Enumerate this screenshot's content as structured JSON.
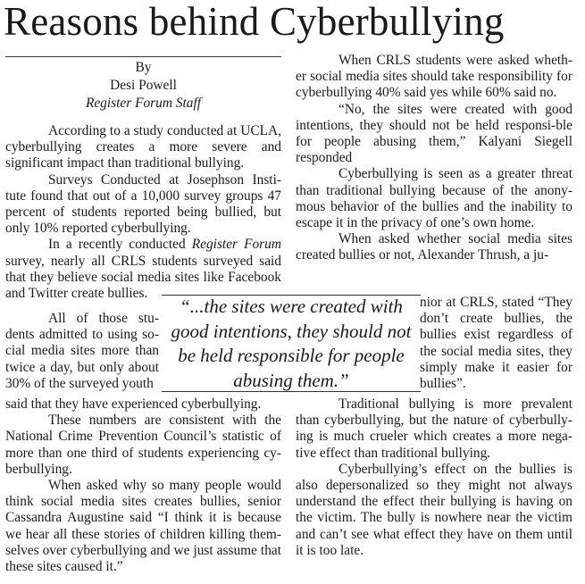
{
  "headline": "Reasons behind Cyberbullying",
  "byline": {
    "by": "By",
    "author": "Desi Powell",
    "staff": "Register Forum Staff"
  },
  "pull_quote": "“...the sites were created with good intentions, they should not be held responsible for people abusing them.”",
  "left_column": {
    "p1": "According to a study conducted at UCLA, cyberbullying creates a more severe and significant impact than traditional bullying.",
    "p2": "Surveys Conducted at Josephson Insti-tute found that out of a 10,000 survey groups 47 percent of students reported being bullied, but only 10% reported cyberbullying.",
    "p3_start": "In a recently conducted ",
    "p3_italic": "Register Forum",
    "p3_end": " survey, nearly all CRLS students surveyed said that they believe social media sites like Facebook and Twitter create bullies.",
    "p4_a": "All of those stu-dents admitted to using so-cial media sites more than twice a day, but only about 30% of the surveyed youth",
    "p4_b": "said that they have experienced cyberbullying.",
    "p5": "These numbers are consistent with the National Crime Prevention Council’s statistic of more than one third of students experiencing cy-berbullying.",
    "p6": "When asked why so many people would think social media sites creates bullies, senior Cassandra Augustine said “I think it is because we hear all these stories of children killing them-selves over cyberbullying and we just assume that these sites caused it.”"
  },
  "right_column": {
    "p1": "When CRLS students were asked wheth-er social media sites should take responsibility for cyberbullying 40% said yes while 60% said no.",
    "p2": "“No, the sites were created with good intentions, they should not be held responsi-ble  for people abusing them,” Kalyani Siegell responded",
    "p3": "Cyberbullying is seen as a greater threat than traditional bullying because of the anony-mous behavior of the bullies and the inability to escape it in the privacy of one’s own home.",
    "p4_a": "When asked whether social media sites created bullies or not, Alexander Thrush, a ju-",
    "p4_b": "nior at CRLS, stated “They don’t create bullies, the bullies exist regardless of the social media sites, they simply make it easier for bullies”.",
    "p5": "Traditional bullying is more prevalent than cyberbullying, but the nature of cyberbully-ing is much crueler which creates a more nega-tive effect than traditional bullying.",
    "p6": "Cyberbullying’s effect on the bullies is also depersonalized so they might not always understand the effect their bullying is having on the victim. The bully is nowhere near the victim and can’t see what effect they have on them until it is too late."
  }
}
